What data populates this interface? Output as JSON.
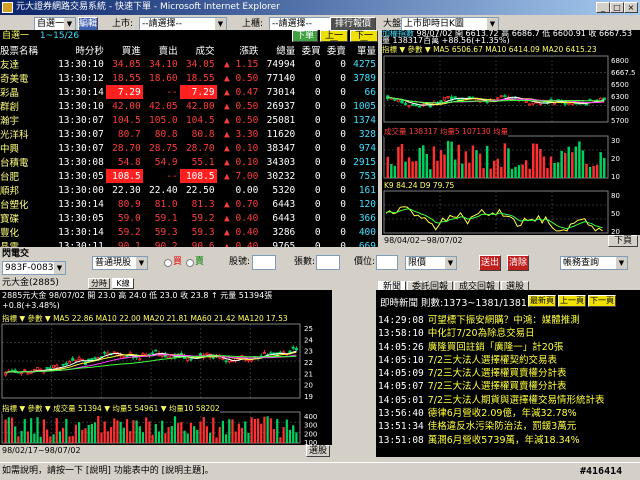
{
  "window": {
    "title": "元大證券網路交易系統 - 快速下單 - Microsoft Internet Explorer"
  },
  "toolbar": {
    "group_select": "自選一",
    "edit_button": "編輯",
    "market_label": "上市:",
    "market_placeholder": "--請選擇--",
    "otc_label": "上櫃:",
    "otc_placeholder": "--請選擇--",
    "ranking_button": "排行報價",
    "chart_label": "大盤",
    "chart_select": "上市即時日K圖"
  },
  "quotes": {
    "group_name": "自選一",
    "page_info": "1~15/26",
    "trade_button": "下單",
    "prev_button": "上一頁",
    "next_button": "下一頁",
    "columns": [
      "股票名稱",
      "時分秒",
      "買進",
      "賣出",
      "成交",
      "漲跌",
      "總量",
      "委買",
      "委賣",
      "單量"
    ],
    "rows": [
      {
        "name": "友達",
        "time": "13:30:10",
        "bid": "34.05",
        "ask": "34.10",
        "last": "34.05",
        "chg": "▲ 1.15",
        "vol": "74994",
        "bq": "0",
        "aq": "0",
        "lot": "4275",
        "c": "red"
      },
      {
        "name": "奇美電",
        "time": "13:30:12",
        "bid": "18.55",
        "ask": "18.60",
        "last": "18.55",
        "chg": "▲ 0.50",
        "vol": "77140",
        "bq": "0",
        "aq": "0",
        "lot": "3789",
        "c": "red"
      },
      {
        "name": "彩晶",
        "time": "13:30:14",
        "bid": "7.29",
        "ask": "--",
        "last": "7.29",
        "chg": "▲ 0.47",
        "vol": "73014",
        "bq": "0",
        "aq": "0",
        "lot": "66",
        "c": "limit"
      },
      {
        "name": "群創",
        "time": "13:30:10",
        "bid": "42.00",
        "ask": "42.05",
        "last": "42.00",
        "chg": "▲ 0.50",
        "vol": "26937",
        "bq": "0",
        "aq": "0",
        "lot": "1005",
        "c": "red"
      },
      {
        "name": "瀚宇",
        "time": "13:30:07",
        "bid": "104.5",
        "ask": "105.0",
        "last": "104.5",
        "chg": "▲ 0.50",
        "vol": "25081",
        "bq": "0",
        "aq": "0",
        "lot": "1374",
        "c": "red"
      },
      {
        "name": "光洋科",
        "time": "13:30:07",
        "bid": "80.7",
        "ask": "80.8",
        "last": "80.8",
        "chg": "▲ 3.30",
        "vol": "11620",
        "bq": "0",
        "aq": "0",
        "lot": "328",
        "c": "red"
      },
      {
        "name": "中興",
        "time": "13:30:07",
        "bid": "28.70",
        "ask": "28.75",
        "last": "28.70",
        "chg": "▲ 0.10",
        "vol": "38347",
        "bq": "0",
        "aq": "0",
        "lot": "974",
        "c": "red"
      },
      {
        "name": "台積電",
        "time": "13:30:08",
        "bid": "54.8",
        "ask": "54.9",
        "last": "55.1",
        "chg": "▲ 0.10",
        "vol": "34303",
        "bq": "0",
        "aq": "0",
        "lot": "2915",
        "c": "red"
      },
      {
        "name": "台肥",
        "time": "13:30:05",
        "bid": "108.5",
        "ask": "--",
        "last": "108.5",
        "chg": "▲ 7.00",
        "vol": "30232",
        "bq": "0",
        "aq": "0",
        "lot": "753",
        "c": "limit"
      },
      {
        "name": "順邦",
        "time": "13:30:00",
        "bid": "22.30",
        "ask": "22.40",
        "last": "22.50",
        "chg": "0.00",
        "vol": "5320",
        "bq": "0",
        "aq": "0",
        "lot": "161",
        "c": "wht"
      },
      {
        "name": "台塑化",
        "time": "13:30:14",
        "bid": "80.9",
        "ask": "81.0",
        "last": "81.3",
        "chg": "▲ 0.70",
        "vol": "6443",
        "bq": "0",
        "aq": "0",
        "lot": "120",
        "c": "red"
      },
      {
        "name": "寶碟",
        "time": "13:30:05",
        "bid": "59.0",
        "ask": "59.1",
        "last": "59.2",
        "chg": "▲ 0.40",
        "vol": "6443",
        "bq": "0",
        "aq": "0",
        "lot": "366",
        "c": "red"
      },
      {
        "name": "豐化",
        "time": "13:30:14",
        "bid": "59.2",
        "ask": "59.3",
        "last": "59.3",
        "chg": "▲ 0.40",
        "vol": "3286",
        "bq": "0",
        "aq": "0",
        "lot": "400",
        "c": "red"
      },
      {
        "name": "晶電",
        "time": "13:30:11",
        "bid": "90.1",
        "ask": "90.2",
        "last": "90.6",
        "chg": "▲ 0.40",
        "vol": "9765",
        "bq": "0",
        "aq": "0",
        "lot": "669",
        "c": "red"
      },
      {
        "name": "證華",
        "time": "13:30:07",
        "bid": "21.15",
        "ask": "21.20",
        "last": "21.35",
        "chg": "▲ 0.55",
        "vol": "52833",
        "bq": "0",
        "aq": "0",
        "lot": "1850",
        "c": "red"
      }
    ]
  },
  "index_chart": {
    "title": "加權指數",
    "info": "98/07/02 開 6613.72 高 6686.7 低 6600.91 收 6667.53 量 138317百萬 +88.56(+1.35%)",
    "ma_label": "指標 ▼ 參數 ▼ MA5 6506.67  MA10 6414.09  MA20 6415.23",
    "vol_label": "成交量 138317 均量5 107130 均量",
    "kd_label": "K9 84.24  D9 79.75",
    "date_range": "98/04/02~98/07/02",
    "next_button": "下頁",
    "price_ticks": [
      "6800",
      "6667.5",
      "6500",
      "6300",
      "6000",
      "5700"
    ],
    "vol_ticks": [
      "30",
      "20",
      "10"
    ],
    "kd_ticks": [
      "80",
      "50",
      "20"
    ]
  },
  "order": {
    "title": "閃電交",
    "account": "983F-0083658",
    "type": "普通現股",
    "buy_label": "買",
    "sell_label": "賣",
    "stock_label": "股號:",
    "qty_label": "張數:",
    "price_label": "價位:",
    "price_type": "限價",
    "submit_button": "送出",
    "clear_button": "清除",
    "query_select": "帳務查詢"
  },
  "stock_chart": {
    "title": "元大金(2885)",
    "tab1": "分時",
    "tab2": "K線",
    "info": "2885元大金 98/07/02 開 23.0 高 24.0 低 23.0 收 23.8 ↑ 元量 51394張 +0.8(+3.48%)",
    "ma_label": "指標 ▼ 參數 ▼ MA5 22.86  MA10 22.00  MA20 21.81  MA60 21.42  MA120 17.53",
    "vol_label": "指標 ▼ 參數 ▼ 成交量 51394 ▼ 均量5 54961 ▼ 均量10 58202",
    "date_range": "98/02/17~98/07/02",
    "next_button": "選股",
    "price_ticks": [
      "25",
      "24",
      "23",
      "22",
      "21",
      "20",
      "19"
    ],
    "vol_ticks": [
      "400",
      "300",
      "200",
      "100"
    ]
  },
  "news": {
    "tabs": [
      "新聞",
      "委託回報",
      "成交回報",
      "選股"
    ],
    "header": "即時新聞  則數:1373~1381/1381",
    "prev_button": "上一頁",
    "next_button": "下一頁",
    "latest_button": "最新頁",
    "items": [
      {
        "time": "14:29:08",
        "text": "可望標下振安網購？中鴻：媒體推測"
      },
      {
        "time": "13:58:10",
        "text": "中化訂7/20為除息交易日"
      },
      {
        "time": "14:05:26",
        "text": "廣隆買回註銷「廣隆一」計20張"
      },
      {
        "time": "14:05:10",
        "text": "7/2三大法人選擇權契約交易表"
      },
      {
        "time": "14:05:09",
        "text": "7/2三大法人選擇權買賣權分計表"
      },
      {
        "time": "14:05:07",
        "text": "7/2三大法人選擇權買賣權分計表"
      },
      {
        "time": "14:05:01",
        "text": "7/2三大法人期貨與選擇權交易情形統計表"
      },
      {
        "time": "13:56:40",
        "text": "德律6月營收2.09億，年減32.78%"
      },
      {
        "time": "13:51:34",
        "text": "佳格違反水污染防治法，罰鍰3萬元"
      },
      {
        "time": "13:51:08",
        "text": "萬潤6月營收5739萬，年減18.34%"
      }
    ]
  },
  "status": {
    "text": "如需說明，請按一下 [說明] 功能表中的 [說明主題]。",
    "code": "#416414"
  }
}
